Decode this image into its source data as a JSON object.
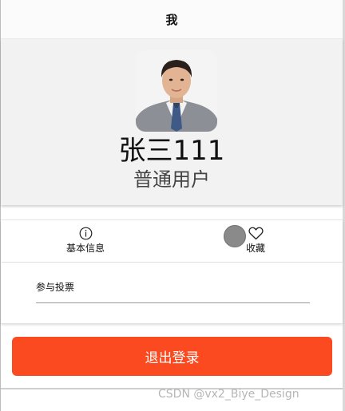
{
  "header": {
    "title": "我"
  },
  "profile": {
    "name": "张三111",
    "role": "普通用户"
  },
  "actions": [
    {
      "label": "基本信息",
      "icon": "info-icon"
    },
    {
      "label": "收藏",
      "icon": "heart-icon"
    }
  ],
  "vote": {
    "label": "参与投票"
  },
  "logout": {
    "label": "退出登录"
  },
  "colors": {
    "accent": "#fb4a20",
    "profile_bg": "#f2f2f2"
  },
  "watermark": "CSDN @vx2_Biye_Design"
}
